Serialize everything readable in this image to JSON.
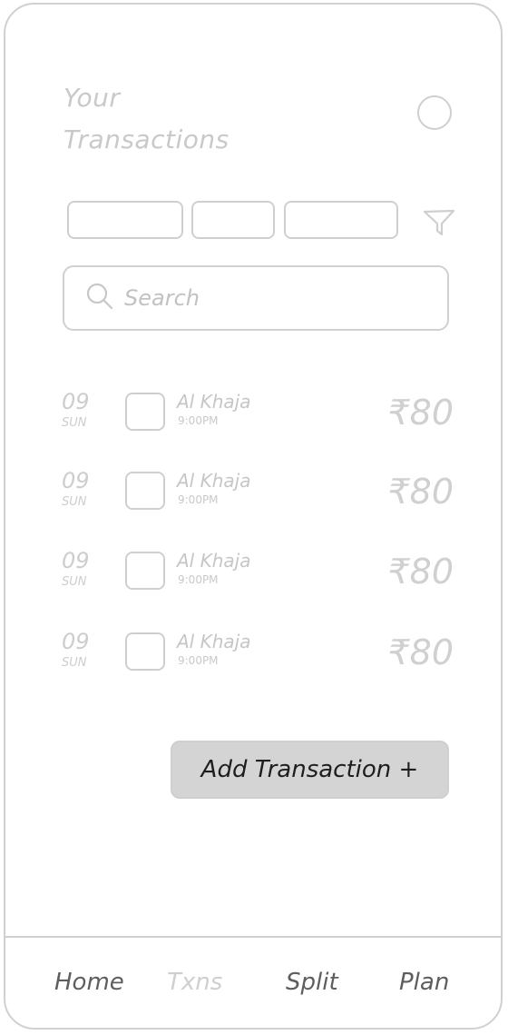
{
  "header": {
    "title_line1": "Your",
    "title_line2": "Transactions"
  },
  "icons": {
    "avatar": "avatar-circle",
    "filter": "filter-funnel-icon",
    "search": "search-icon"
  },
  "filters": {
    "chips": [
      "",
      "",
      ""
    ]
  },
  "search": {
    "placeholder": "Search",
    "value": ""
  },
  "transactions": [
    {
      "day": "09",
      "weekday": "SUN",
      "name": "Al Khaja",
      "time": "9:00PM",
      "amount": "₹80"
    },
    {
      "day": "09",
      "weekday": "SUN",
      "name": "Al Khaja",
      "time": "9:00PM",
      "amount": "₹80"
    },
    {
      "day": "09",
      "weekday": "SUN",
      "name": "Al Khaja",
      "time": "9:00PM",
      "amount": "₹80"
    },
    {
      "day": "09",
      "weekday": "SUN",
      "name": "Al Khaja",
      "time": "9:00PM",
      "amount": "₹80"
    }
  ],
  "actions": {
    "add_transaction_label": "Add Transaction +"
  },
  "nav": {
    "items": [
      {
        "label": "Home"
      },
      {
        "label": "Txns"
      },
      {
        "label": "Split"
      },
      {
        "label": "Plan"
      }
    ],
    "active": "Txns"
  },
  "colors": {
    "outline": "#d0d0d0",
    "muted_text": "#c8c8c8",
    "button_bg": "#d4d4d4",
    "button_text": "#1e1e1e",
    "nav_text": "#5e5e5e"
  }
}
